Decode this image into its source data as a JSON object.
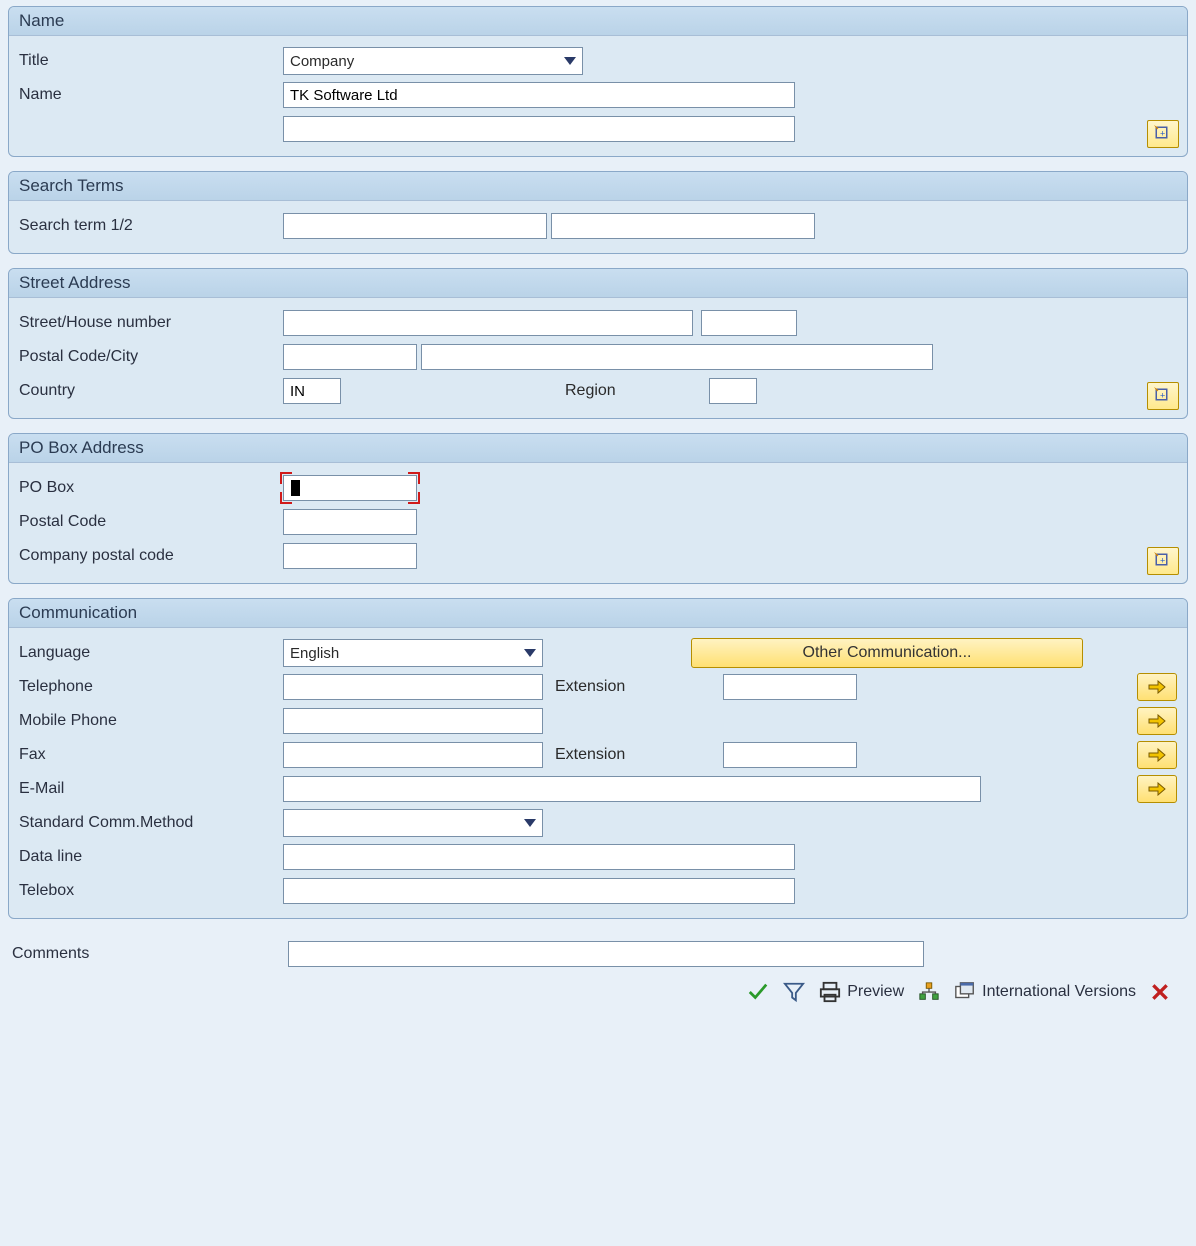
{
  "panels": {
    "name": {
      "header": "Name",
      "labels": {
        "title": "Title",
        "name": "Name"
      },
      "values": {
        "title_select": "Company",
        "name1": "TK Software Ltd",
        "name2": ""
      }
    },
    "search": {
      "header": "Search Terms",
      "labels": {
        "term": "Search term 1/2"
      },
      "values": {
        "term1": "",
        "term2": ""
      }
    },
    "street": {
      "header": "Street Address",
      "labels": {
        "street": "Street/House number",
        "postal": "Postal Code/City",
        "country": "Country",
        "region": "Region"
      },
      "values": {
        "street": "",
        "house": "",
        "postcode": "",
        "city": "",
        "country": "IN",
        "region": ""
      }
    },
    "pobox": {
      "header": "PO Box Address",
      "labels": {
        "pobox": "PO Box",
        "postcode": "Postal Code",
        "companypc": "Company postal code"
      },
      "values": {
        "pobox": "",
        "postcode": "",
        "companypc": ""
      }
    },
    "comm": {
      "header": "Communication",
      "labels": {
        "language": "Language",
        "telephone": "Telephone",
        "extension": "Extension",
        "mobile": "Mobile Phone",
        "fax": "Fax",
        "email": "E-Mail",
        "stdmethod": "Standard Comm.Method",
        "dataline": "Data line",
        "telebox": "Telebox"
      },
      "values": {
        "language_select": "English",
        "telephone": "",
        "tel_ext": "",
        "mobile": "",
        "fax": "",
        "fax_ext": "",
        "email": "",
        "std_method": "",
        "dataline": "",
        "telebox": ""
      },
      "other_comm_btn": "Other Communication..."
    }
  },
  "comments_label": "Comments",
  "comments_value": "",
  "toolbar": {
    "preview": "Preview",
    "international": "International Versions"
  }
}
